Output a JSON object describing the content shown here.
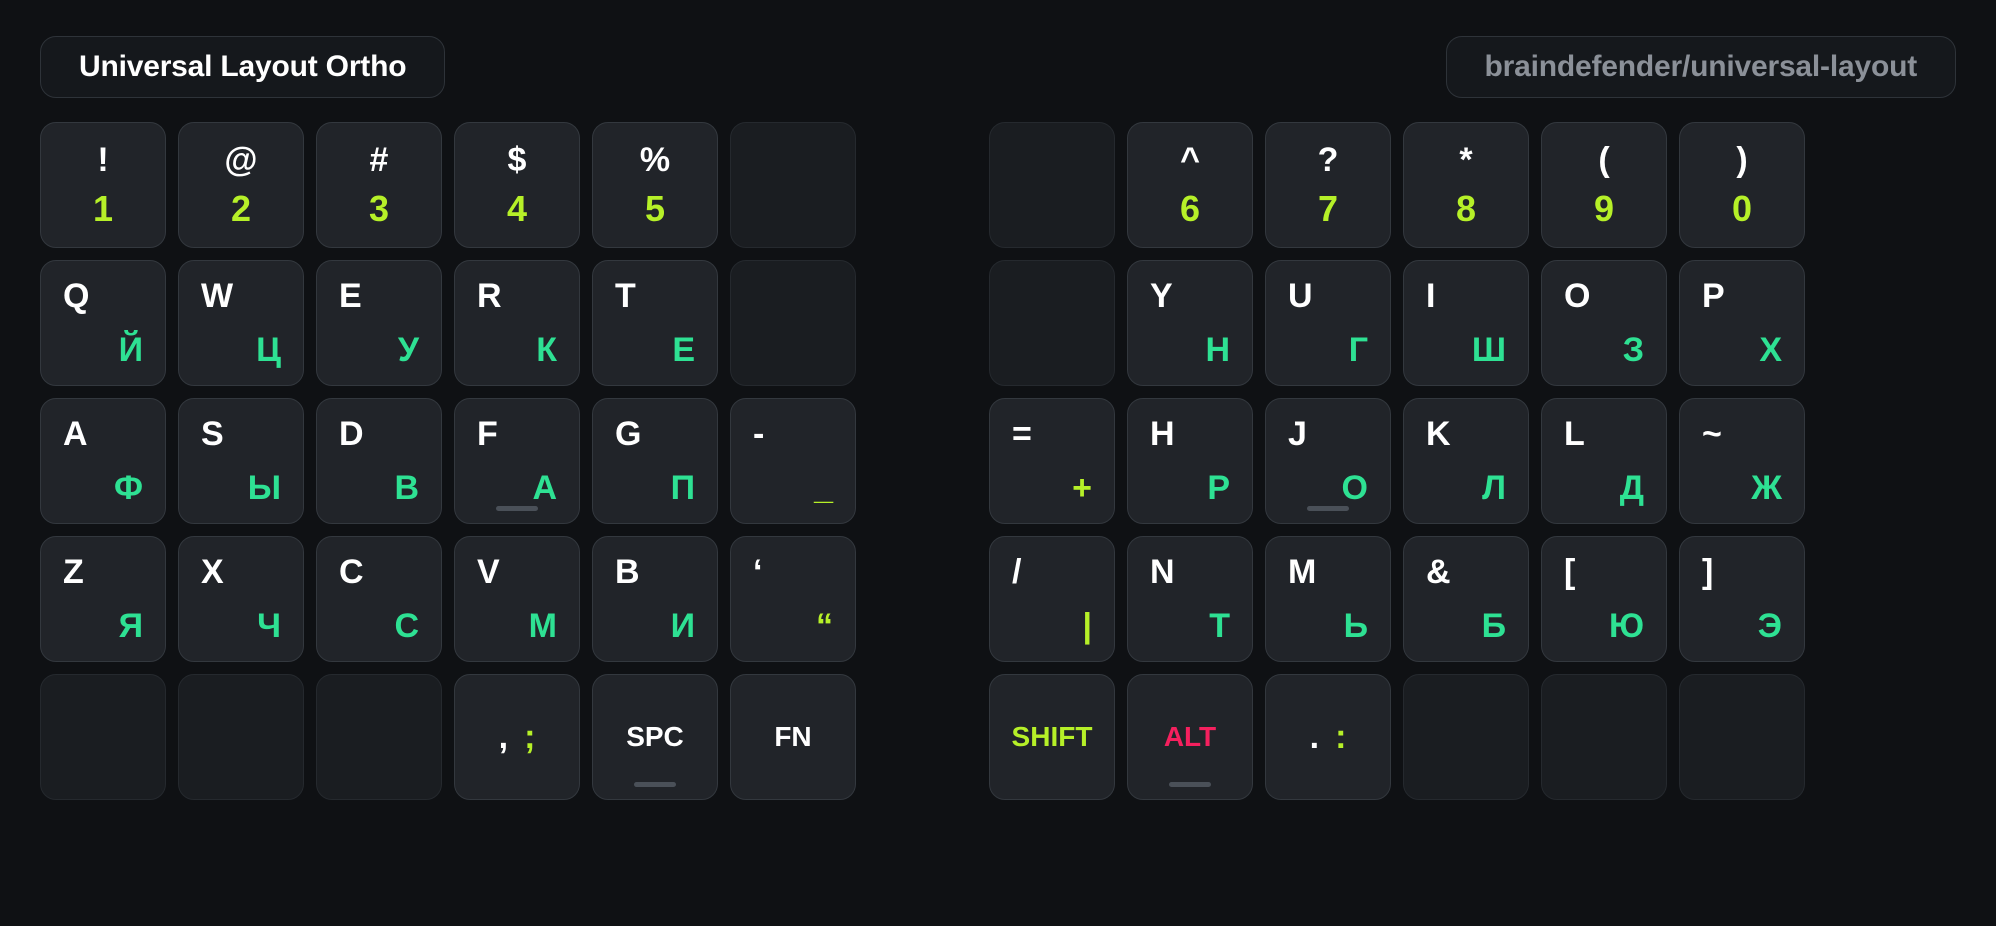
{
  "header": {
    "title": "Universal Layout Ortho",
    "repo": "braindefender/universal-layout"
  },
  "colors": {
    "background": "#0f1114",
    "key_face": "#212429",
    "key_blank": "#1a1d21",
    "key_border": "#33383e",
    "latin": "#ffffff",
    "cyrillic": "#2ee193",
    "symbol_alt": "#b6f028",
    "shift": "#b6f028",
    "alt": "#f5205e",
    "repo_text": "#8b9098",
    "homing_bar": "#4a5058"
  },
  "keyboard": {
    "rows": [
      {
        "left": [
          {
            "type": "pair_stacked",
            "top": "!",
            "bottom": "1",
            "bottom_color": "lime"
          },
          {
            "type": "pair_stacked",
            "top": "@",
            "bottom": "2",
            "bottom_color": "lime"
          },
          {
            "type": "pair_stacked",
            "top": "#",
            "bottom": "3",
            "bottom_color": "lime"
          },
          {
            "type": "pair_stacked",
            "top": "$",
            "bottom": "4",
            "bottom_color": "lime"
          },
          {
            "type": "pair_stacked",
            "top": "%",
            "bottom": "5",
            "bottom_color": "lime"
          },
          {
            "type": "blank"
          }
        ],
        "right": [
          {
            "type": "blank"
          },
          {
            "type": "pair_stacked",
            "top": "^",
            "bottom": "6",
            "bottom_color": "lime"
          },
          {
            "type": "pair_stacked",
            "top": "?",
            "bottom": "7",
            "bottom_color": "lime"
          },
          {
            "type": "pair_stacked",
            "top": "*",
            "bottom": "8",
            "bottom_color": "lime"
          },
          {
            "type": "pair_stacked",
            "top": "(",
            "bottom": "9",
            "bottom_color": "lime"
          },
          {
            "type": "pair_stacked",
            "top": ")",
            "bottom": "0",
            "bottom_color": "lime"
          }
        ]
      },
      {
        "left": [
          {
            "type": "pair_corner",
            "primary": "Q",
            "secondary": "Й",
            "secondary_color": "green"
          },
          {
            "type": "pair_corner",
            "primary": "W",
            "secondary": "Ц",
            "secondary_color": "green"
          },
          {
            "type": "pair_corner",
            "primary": "E",
            "secondary": "У",
            "secondary_color": "green"
          },
          {
            "type": "pair_corner",
            "primary": "R",
            "secondary": "К",
            "secondary_color": "green"
          },
          {
            "type": "pair_corner",
            "primary": "T",
            "secondary": "Е",
            "secondary_color": "green"
          },
          {
            "type": "blank"
          }
        ],
        "right": [
          {
            "type": "blank"
          },
          {
            "type": "pair_corner",
            "primary": "Y",
            "secondary": "Н",
            "secondary_color": "green"
          },
          {
            "type": "pair_corner",
            "primary": "U",
            "secondary": "Г",
            "secondary_color": "green"
          },
          {
            "type": "pair_corner",
            "primary": "I",
            "secondary": "Ш",
            "secondary_color": "green"
          },
          {
            "type": "pair_corner",
            "primary": "O",
            "secondary": "З",
            "secondary_color": "green"
          },
          {
            "type": "pair_corner",
            "primary": "P",
            "secondary": "Х",
            "secondary_color": "green"
          }
        ]
      },
      {
        "left": [
          {
            "type": "pair_corner",
            "primary": "A",
            "secondary": "Ф",
            "secondary_color": "green"
          },
          {
            "type": "pair_corner",
            "primary": "S",
            "secondary": "Ы",
            "secondary_color": "green"
          },
          {
            "type": "pair_corner",
            "primary": "D",
            "secondary": "В",
            "secondary_color": "green"
          },
          {
            "type": "pair_corner",
            "primary": "F",
            "secondary": "А",
            "secondary_color": "green",
            "homing": true
          },
          {
            "type": "pair_corner",
            "primary": "G",
            "secondary": "П",
            "secondary_color": "green"
          },
          {
            "type": "pair_corner",
            "primary": "-",
            "secondary": "_",
            "secondary_color": "lime"
          }
        ],
        "right": [
          {
            "type": "pair_corner",
            "primary": "=",
            "secondary": "+",
            "secondary_color": "lime"
          },
          {
            "type": "pair_corner",
            "primary": "H",
            "secondary": "Р",
            "secondary_color": "green"
          },
          {
            "type": "pair_corner",
            "primary": "J",
            "secondary": "О",
            "secondary_color": "green",
            "homing": true
          },
          {
            "type": "pair_corner",
            "primary": "K",
            "secondary": "Л",
            "secondary_color": "green"
          },
          {
            "type": "pair_corner",
            "primary": "L",
            "secondary": "Д",
            "secondary_color": "green"
          },
          {
            "type": "pair_corner",
            "primary": "~",
            "secondary": "Ж",
            "secondary_color": "green"
          }
        ]
      },
      {
        "left": [
          {
            "type": "pair_corner",
            "primary": "Z",
            "secondary": "Я",
            "secondary_color": "green"
          },
          {
            "type": "pair_corner",
            "primary": "X",
            "secondary": "Ч",
            "secondary_color": "green"
          },
          {
            "type": "pair_corner",
            "primary": "C",
            "secondary": "С",
            "secondary_color": "green"
          },
          {
            "type": "pair_corner",
            "primary": "V",
            "secondary": "М",
            "secondary_color": "green"
          },
          {
            "type": "pair_corner",
            "primary": "B",
            "secondary": "И",
            "secondary_color": "green"
          },
          {
            "type": "pair_corner",
            "primary": "‘",
            "secondary": "“",
            "secondary_color": "lime"
          }
        ],
        "right": [
          {
            "type": "pair_corner",
            "primary": "/",
            "secondary": "|",
            "secondary_color": "lime"
          },
          {
            "type": "pair_corner",
            "primary": "N",
            "secondary": "Т",
            "secondary_color": "green"
          },
          {
            "type": "pair_corner",
            "primary": "M",
            "secondary": "Ь",
            "secondary_color": "green"
          },
          {
            "type": "pair_corner",
            "primary": "&",
            "secondary": "Б",
            "secondary_color": "green"
          },
          {
            "type": "pair_corner",
            "primary": "[",
            "secondary": "Ю",
            "secondary_color": "green"
          },
          {
            "type": "pair_corner",
            "primary": "]",
            "secondary": "Э",
            "secondary_color": "green"
          }
        ]
      },
      {
        "left": [
          {
            "type": "blank"
          },
          {
            "type": "blank"
          },
          {
            "type": "blank"
          },
          {
            "type": "pair_inline",
            "a": ",",
            "b": ";"
          },
          {
            "type": "label",
            "label": "SPC",
            "label_color": "white",
            "homing": true
          },
          {
            "type": "label",
            "label": "FN",
            "label_color": "white"
          }
        ],
        "right": [
          {
            "type": "label",
            "label": "SHIFT",
            "label_color": "lime"
          },
          {
            "type": "label",
            "label": "ALT",
            "label_color": "pink",
            "homing": true
          },
          {
            "type": "pair_inline",
            "a": ".",
            "b": ":"
          },
          {
            "type": "blank"
          },
          {
            "type": "blank"
          },
          {
            "type": "blank"
          }
        ]
      }
    ]
  }
}
